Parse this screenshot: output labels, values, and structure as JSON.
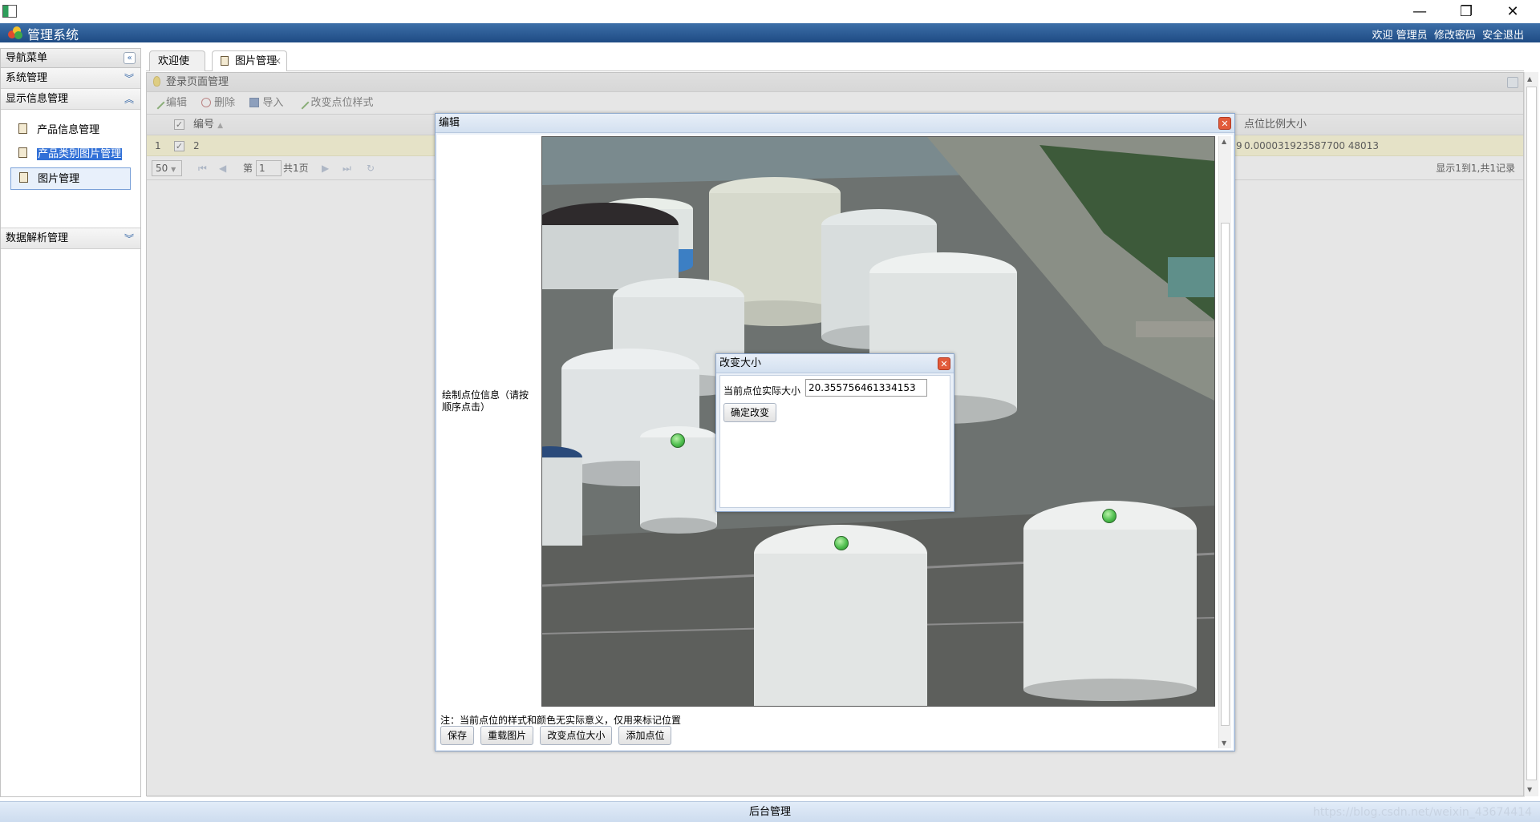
{
  "window": {
    "minimize_glyph": "—",
    "maximize_glyph": "❐",
    "close_glyph": "✕"
  },
  "header": {
    "title": "管理系统",
    "welcome": "欢迎 管理员",
    "change_password": "修改密码",
    "logout": "安全退出"
  },
  "sidebar": {
    "title": "导航菜单",
    "sections": [
      {
        "label": "系统管理"
      },
      {
        "label": "显示信息管理"
      },
      {
        "label": "数据解析管理"
      }
    ],
    "items": [
      {
        "label": "产品信息管理"
      },
      {
        "label": "产品类别图片管理"
      },
      {
        "label": "图片管理"
      }
    ]
  },
  "tabs": [
    {
      "label": "欢迎使用"
    },
    {
      "label": "图片管理"
    }
  ],
  "panel": {
    "title": "登录页面管理",
    "toolbar": [
      {
        "label": "编辑",
        "icon": "pencil-icon"
      },
      {
        "label": "删除",
        "icon": "scissors-icon"
      },
      {
        "label": "导入",
        "icon": "disk-icon"
      },
      {
        "label": "改变点位样式",
        "icon": "pencil-icon"
      }
    ],
    "grid": {
      "columns": [
        "编号",
        "点位比例大小"
      ],
      "rows": [
        {
          "index": "1",
          "id": "2",
          "ratio_cut": "9",
          "ratio": "0.000031923587700 48013"
        }
      ]
    },
    "pager": {
      "page_size": "50",
      "page_prefix": "第",
      "page_value": "1",
      "page_total": "共1页",
      "summary": "显示1到1,共1记录"
    }
  },
  "edit_dialog": {
    "title": "编辑",
    "draw_label": "绘制点位信息（请按顺序点击）",
    "note": "注：当前点位的样式和颜色无实际意义，仅用来标记位置",
    "buttons": [
      "保存",
      "重载图片",
      "改变点位大小",
      "添加点位"
    ]
  },
  "resize_dialog": {
    "title": "改变大小",
    "label": "当前点位实际大小",
    "value": "20.355756461334153",
    "confirm": "确定改变"
  },
  "footer": {
    "text": "后台管理",
    "watermark": "https://blog.csdn.net/weixin_43674414"
  },
  "colors": {
    "header_bg": "#1e4b84",
    "selected_row": "#fdf7c6",
    "marker": "#4fbf4f",
    "close_btn": "#e25b3a"
  }
}
